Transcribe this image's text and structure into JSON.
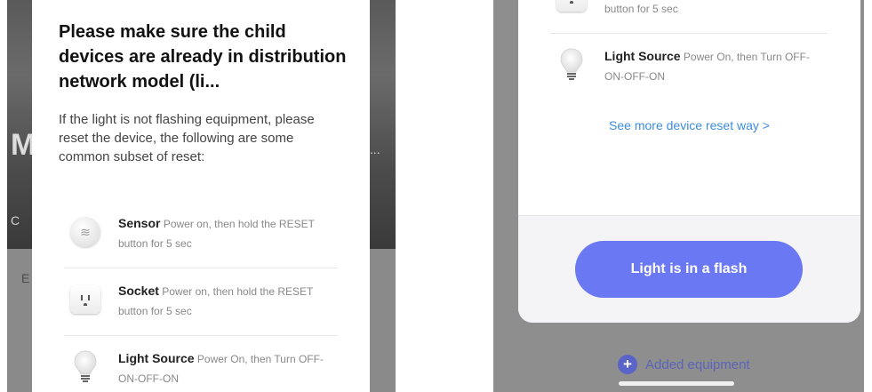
{
  "left_background": {
    "letter_m": "M",
    "letter_c": "C",
    "letter_e": "E",
    "ellipsis": "..."
  },
  "left_modal": {
    "title": "Please make sure the child devices are already in distribution network model (li...",
    "description": "If the light is not flashing equipment, please reset the device, the following are some common subset of reset:",
    "devices": [
      {
        "icon": "sensor-icon",
        "name": "Sensor",
        "instruction": "Power on, then hold the RESET button for 5 sec"
      },
      {
        "icon": "socket-icon",
        "name": "Socket",
        "instruction": "Power on, then hold the RESET button for 5 sec"
      },
      {
        "icon": "light-bulb-icon",
        "name": "Light Source",
        "instruction": "Power On, then Turn OFF-ON-OFF-ON"
      }
    ]
  },
  "right_modal": {
    "partial_instruction": "button for 5 sec",
    "device": {
      "icon": "light-bulb-icon",
      "name": "Light Source",
      "instruction": "Power On, then Turn OFF-ON-OFF-ON"
    },
    "see_more_link": "See more device reset way >",
    "primary_button": "Light is in a flash"
  },
  "right_background": {
    "added_equipment": "Added equipment",
    "plus_symbol": "+"
  },
  "colors": {
    "accent_button": "#6a78f4",
    "link": "#3d8de0"
  }
}
